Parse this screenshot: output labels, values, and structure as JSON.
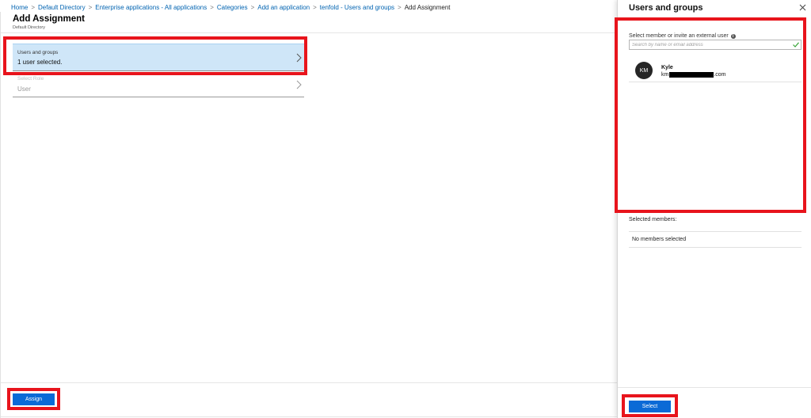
{
  "breadcrumb": {
    "items": [
      "Home",
      "Default Directory",
      "Enterprise applications - All applications",
      "Categories",
      "Add an application",
      "tenfold - Users and groups",
      "Add Assignment"
    ],
    "separator": ">"
  },
  "blade": {
    "title": "Add Assignment",
    "subtitle": "Default Directory",
    "users_field": {
      "label": "Users and groups",
      "value": "1 user selected."
    },
    "role_field": {
      "label": "Select Role",
      "value": "User"
    },
    "assign_label": "Assign"
  },
  "panel": {
    "title": "Users and groups",
    "search_label": "Select member or invite an external user",
    "search_placeholder": "Search by name or email address",
    "result": {
      "initials": "KM",
      "name": "Kyle",
      "email_prefix": "km",
      "email_suffix": ".com"
    },
    "selected_label": "Selected members:",
    "no_members": "No members selected",
    "select_label": "Select"
  },
  "colors": {
    "link": "#0063b1",
    "primary_button": "#0b6ad6",
    "selected_field": "#cfe6f8",
    "annotation": "#e8141c"
  },
  "icons": {
    "close": "close-icon",
    "info": "info-icon",
    "check": "check-icon",
    "chevron": "chevron-right-icon"
  }
}
